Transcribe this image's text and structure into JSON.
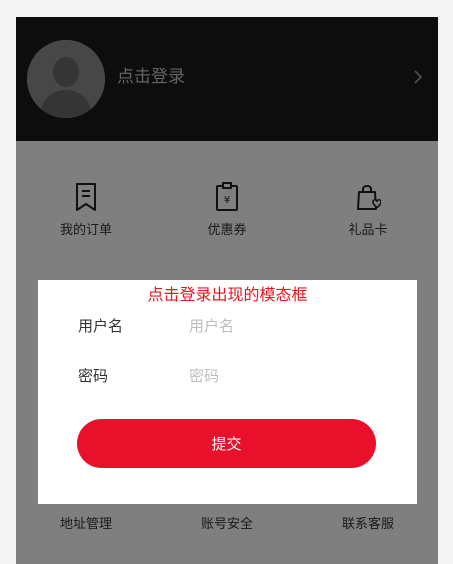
{
  "header": {
    "login_label": "点击登录"
  },
  "menu": {
    "row1": [
      {
        "label": "我的订单",
        "icon": "bookmark-icon"
      },
      {
        "label": "优惠券",
        "icon": "coupon-icon"
      },
      {
        "label": "礼品卡",
        "icon": "gift-bag-icon"
      }
    ],
    "row2": [
      {
        "label": "地址管理"
      },
      {
        "label": "账号安全"
      },
      {
        "label": "联系客服"
      }
    ]
  },
  "modal": {
    "title": "点击登录出现的模态框",
    "username_label": "用户名",
    "username_placeholder": "用户名",
    "password_label": "密码",
    "password_placeholder": "密码",
    "submit_label": "提交"
  },
  "colors": {
    "header_bg": "#1a1a1a",
    "accent": "#e8102a",
    "title_red": "#e8161e"
  }
}
